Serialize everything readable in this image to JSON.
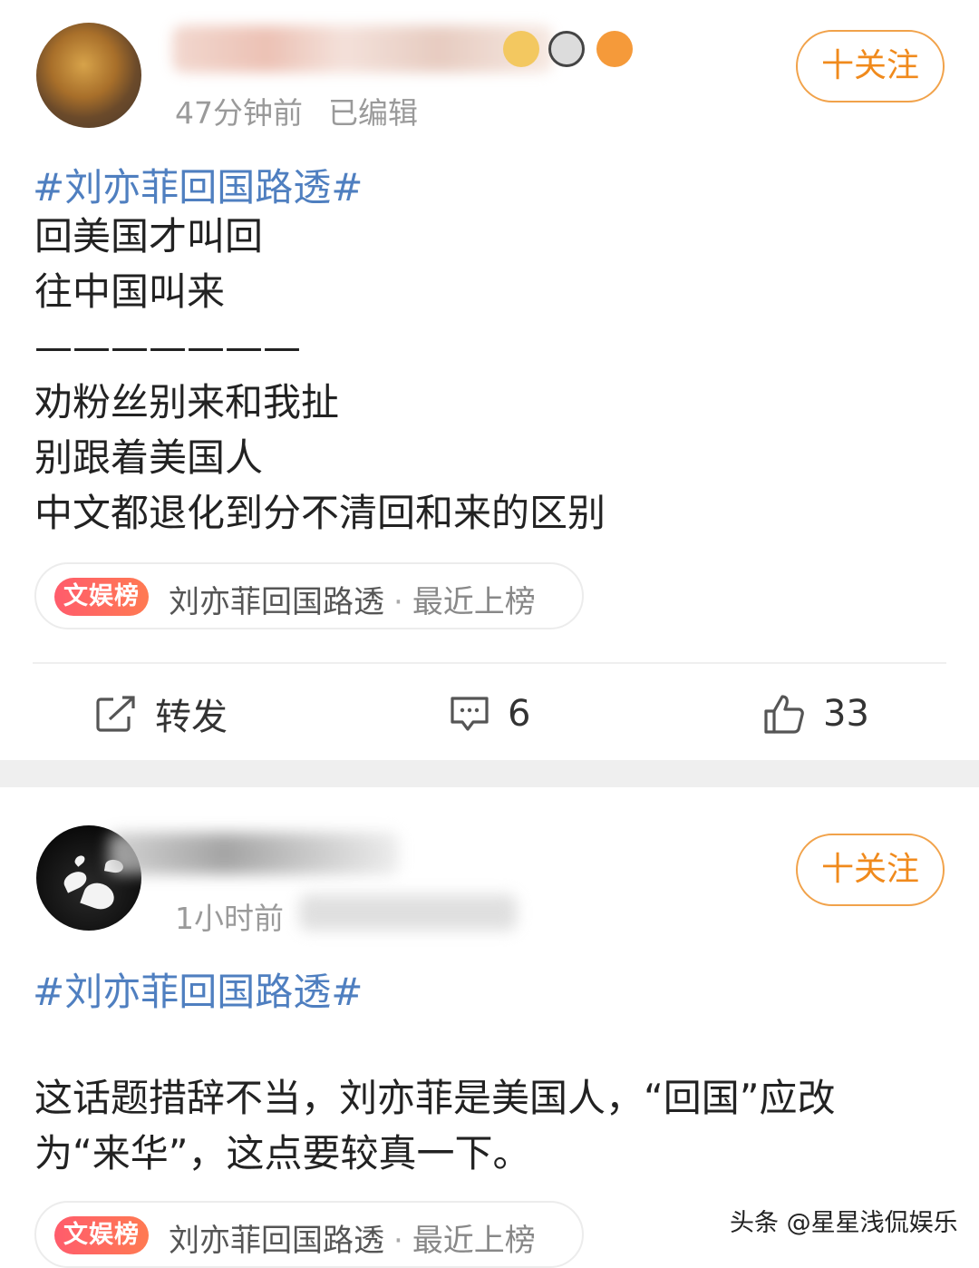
{
  "posts": [
    {
      "meta": {
        "time": "47分钟前",
        "edited": "已编辑"
      },
      "follow_label": "十关注",
      "topic": "#刘亦菲回国路透#",
      "body": [
        "回美国才叫回",
        "往中国叫来",
        "———————",
        "劝粉丝别来和我扯",
        "别跟着美国人",
        "中文都退化到分不清回和来的区别"
      ],
      "tag": {
        "badge": "文娱榜",
        "name": "刘亦菲回国路透",
        "separator": "·",
        "status": "最近上榜"
      },
      "actions": {
        "repost": "转发",
        "comments": "6",
        "likes": "33"
      }
    },
    {
      "meta": {
        "time": "1小时前"
      },
      "follow_label": "十关注",
      "topic": "#刘亦菲回国路透#",
      "body": [
        "这话题措辞不当，刘亦菲是美国人，“回国”应改",
        "为“来华”，这点要较真一下。"
      ],
      "tag": {
        "badge": "文娱榜",
        "name": "刘亦菲回国路透",
        "separator": "·",
        "status": "最近上榜"
      }
    }
  ],
  "watermark": "头条 @星星浅侃娱乐",
  "colors": {
    "topic": "#4f7fc0",
    "follow": "#f08a1c",
    "badge_start": "#ff5c6c",
    "badge_end": "#ff7a52"
  },
  "icons": [
    "repost-icon",
    "comment-icon",
    "like-icon"
  ]
}
